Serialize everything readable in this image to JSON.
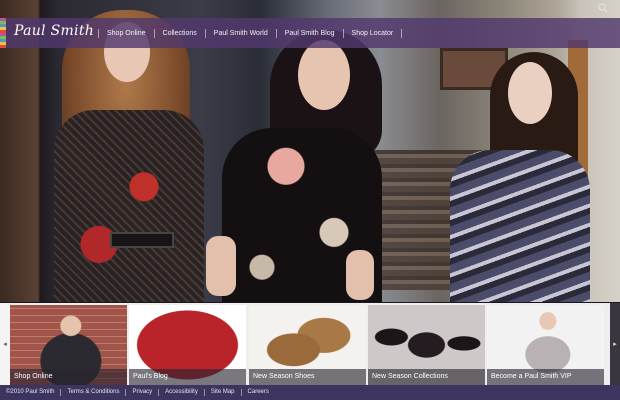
{
  "brand": {
    "logo_text": "Paul Smith",
    "stripe_colors": [
      "#e04a3a",
      "#f0c040",
      "#4a9ad0",
      "#7ac04a",
      "#c050a0"
    ]
  },
  "nav": {
    "items": [
      {
        "label": "Shop Online"
      },
      {
        "label": "Collections"
      },
      {
        "label": "Paul Smith World"
      },
      {
        "label": "Paul Smith Blog"
      },
      {
        "label": "Shop Locator"
      }
    ],
    "bar_color": "#52386e"
  },
  "search": {
    "icon": "search-icon"
  },
  "strip": {
    "prev_icon": "chevron-left-icon",
    "next_icon": "chevron-right-icon",
    "prev_glyph": "◂",
    "next_glyph": "▸",
    "items": [
      {
        "caption": "Shop Online"
      },
      {
        "caption": "Paul's Blog"
      },
      {
        "caption": "New Season Shoes"
      },
      {
        "caption": "New Season Collections"
      },
      {
        "caption": "Become a Paul Smith VIP"
      }
    ]
  },
  "footer": {
    "items": [
      {
        "label": "©2010 Paul Smith"
      },
      {
        "label": "Terms & Conditions"
      },
      {
        "label": "Privacy"
      },
      {
        "label": "Accessibility"
      },
      {
        "label": "Site Map"
      },
      {
        "label": "Careers"
      }
    ]
  }
}
